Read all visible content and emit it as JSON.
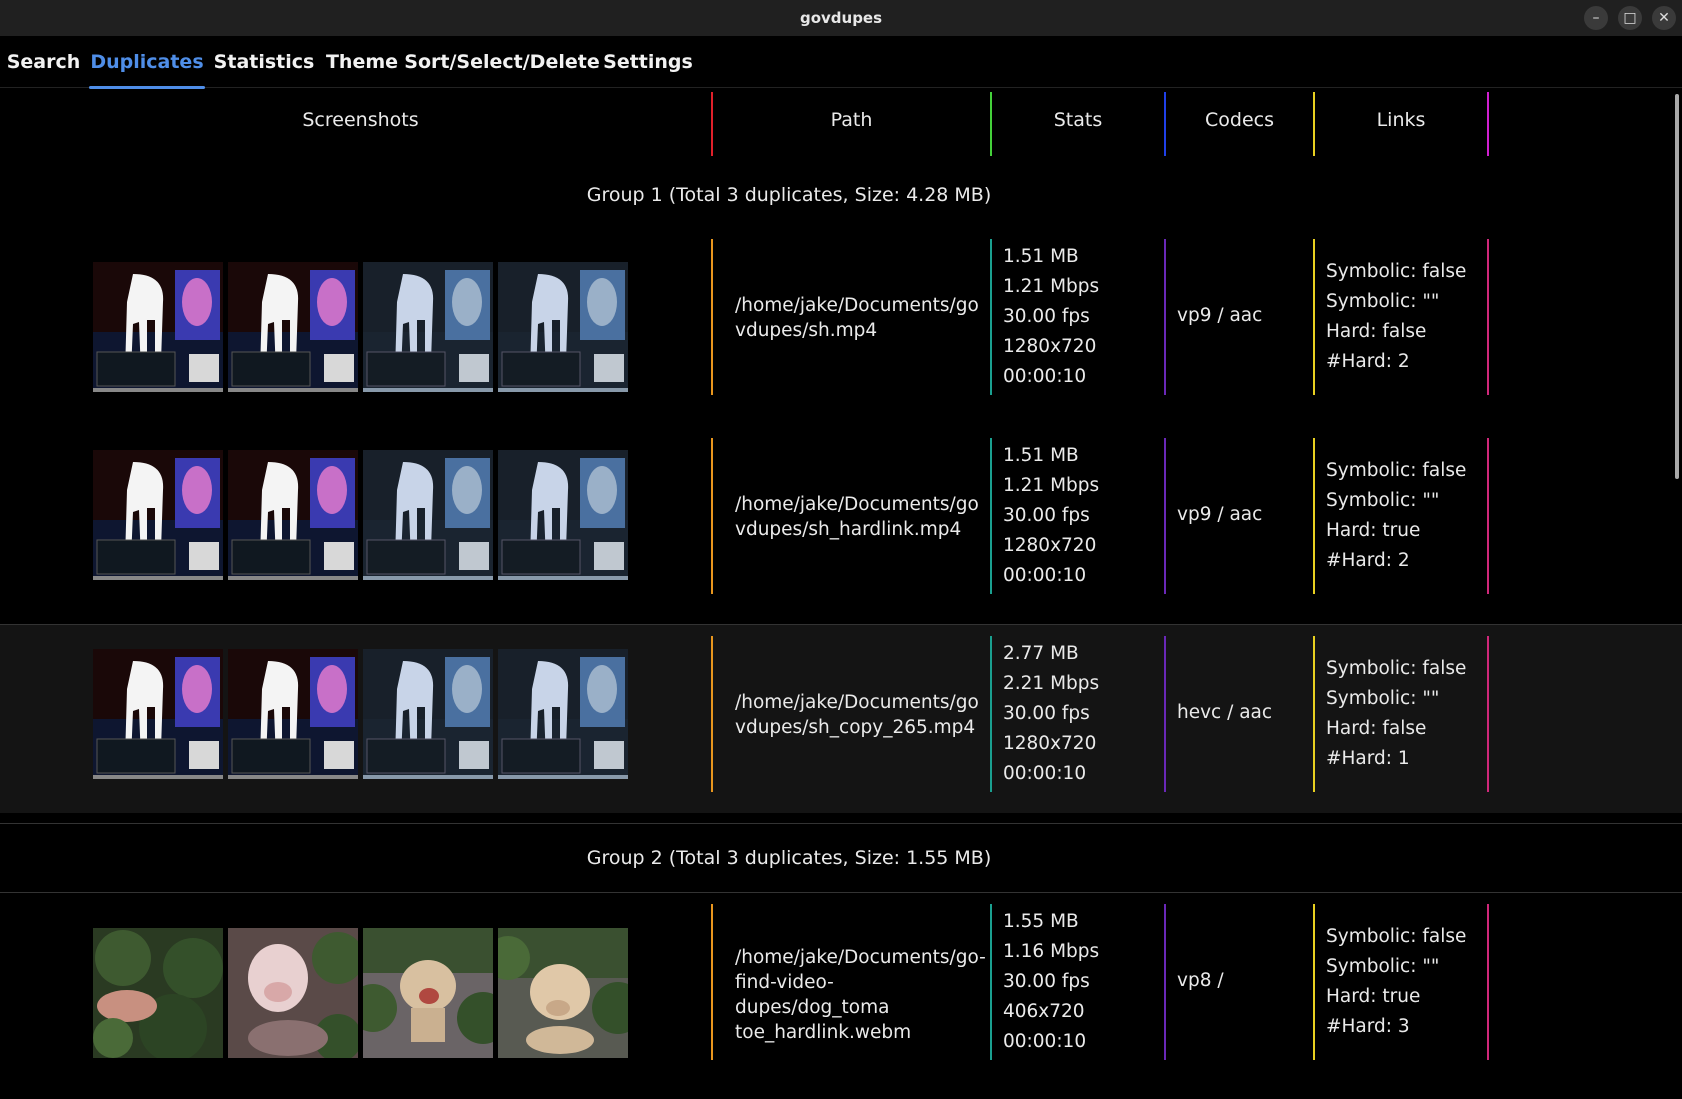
{
  "window": {
    "title": "govdupes"
  },
  "tabs": [
    {
      "label": "Search"
    },
    {
      "label": "Duplicates"
    },
    {
      "label": "Statistics"
    },
    {
      "label": "Theme"
    },
    {
      "label": "Sort/Select/Delete"
    },
    {
      "label": "Settings"
    }
  ],
  "active_tab": "Duplicates",
  "columns": {
    "screenshots": "Screenshots",
    "path": "Path",
    "stats": "Stats",
    "codecs": "Codecs",
    "links": "Links"
  },
  "column_colors": [
    "#e0202a",
    "#44d13a",
    "#2040e8",
    "#e8d020",
    "#d020d0"
  ],
  "row_divider_colors": [
    "#e8961e",
    "#1aa090",
    "#6a28b8",
    "#e8d020",
    "#d0287a"
  ],
  "groups": [
    {
      "title": "Group 1 (Total 3 duplicates, Size: 4.28 MB)",
      "items": [
        {
          "path_line1": "/home/jake/Documents/go",
          "path_line2": "vdupes/sh.mp4",
          "path_line3": "",
          "size": "1.51 MB",
          "bitrate": "1.21 Mbps",
          "fps": "30.00 fps",
          "resolution": "1280x720",
          "duration": "00:00:10",
          "codecs": "vp9 / aac",
          "symbolic": "Symbolic: false",
          "symbolic_target": "Symbolic: \"\"",
          "hard": "Hard: false",
          "hard_count": "#Hard: 2"
        },
        {
          "path_line1": "/home/jake/Documents/go",
          "path_line2": "vdupes/sh_hardlink.mp4",
          "path_line3": "",
          "size": "1.51 MB",
          "bitrate": "1.21 Mbps",
          "fps": "30.00 fps",
          "resolution": "1280x720",
          "duration": "00:00:10",
          "codecs": "vp9 / aac",
          "symbolic": "Symbolic: false",
          "symbolic_target": "Symbolic: \"\"",
          "hard": "Hard: true",
          "hard_count": "#Hard: 2"
        },
        {
          "path_line1": "/home/jake/Documents/go",
          "path_line2": "vdupes/sh_copy_265.mp4",
          "path_line3": "",
          "size": "2.77 MB",
          "bitrate": "2.21 Mbps",
          "fps": "30.00 fps",
          "resolution": "1280x720",
          "duration": "00:00:10",
          "codecs": "hevc / aac",
          "symbolic": "Symbolic: false",
          "symbolic_target": "Symbolic: \"\"",
          "hard": "Hard: false",
          "hard_count": "#Hard: 1"
        }
      ]
    },
    {
      "title": "Group 2 (Total 3 duplicates, Size: 1.55 MB)",
      "items": [
        {
          "path_line1": "/home/jake/Documents/go-",
          "path_line2": "find-video-dupes/dog_toma",
          "path_line3": "toe_hardlink.webm",
          "size": "1.55 MB",
          "bitrate": "1.16 Mbps",
          "fps": "30.00 fps",
          "resolution": "406x720",
          "duration": "00:00:10",
          "codecs": "vp8 /",
          "symbolic": "Symbolic: false",
          "symbolic_target": "Symbolic: \"\"",
          "hard": "Hard: true",
          "hard_count": "#Hard: 3"
        }
      ]
    }
  ],
  "icons": {
    "minimize": "minimize-icon",
    "maximize": "maximize-icon",
    "close": "close-icon"
  },
  "window_buttons": {
    "minimize": "–",
    "maximize": "□",
    "close": "✕"
  }
}
